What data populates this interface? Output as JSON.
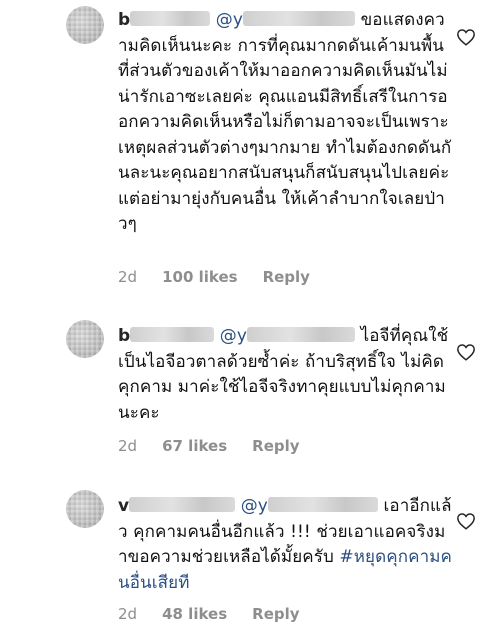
{
  "comments": [
    {
      "username_visible": "b",
      "mention_visible": "@y",
      "text_after_mention": " ขอแสดงความคิดเห็นนะคะ การที่คุณมากดดันเค้ามนพื้นที่ส่วนตัวของเค้าให้มาออกความคิดเห็นมันไม่น่ารักเอาซะเลยค่ะ คุณแอนมีสิทธิ์เสรีในการออกความคิดเห็นหรือไม่ก็ตามอาจจะเป็นเพราะเหตุผลส่วนตัวต่างๆมากมาย ทำไมต้องกดดันกันละนะคุณอยากสนับสนุนก็สนับสนุนไปเลยค่ะ แต่อย่ามายุ่งกับคนอื่น ให้เค้าลำบากใจเลยป่าวๆ",
      "time": "2d",
      "likes": "100 likes",
      "reply": "Reply"
    },
    {
      "username_visible": "b",
      "mention_visible": "@y",
      "text_after_mention": " ไอจีที่คุณใช้ เป็นไอจีอวตาลด้วยซ้ำค่ะ ถ้าบริสุทธิ์ใจ ไม่คิดคุกคาม มาค่ะใช้ไอจีจริงทาคุยแบบไม่คุกคามนะคะ",
      "time": "2d",
      "likes": "67 likes",
      "reply": "Reply"
    },
    {
      "username_visible": "v",
      "mention_visible": "@y",
      "text_after_mention": " เอาอีกแล้ว คุกคามคนอื่นอีกแล้ว !!! ช่วยเอาแอคจริงมาขอความช่วยเหลือได้มั้ยครับ ",
      "hashtag": "#หยุดคุกคามคนอื่นเสียที",
      "time": "2d",
      "likes": "48 likes",
      "reply": "Reply"
    }
  ],
  "icons": {
    "like": "heart-outline-icon",
    "avatar": "avatar-blurred"
  },
  "colors": {
    "link": "#2a4f82",
    "meta": "#8e8e8e",
    "text": "#111111"
  }
}
